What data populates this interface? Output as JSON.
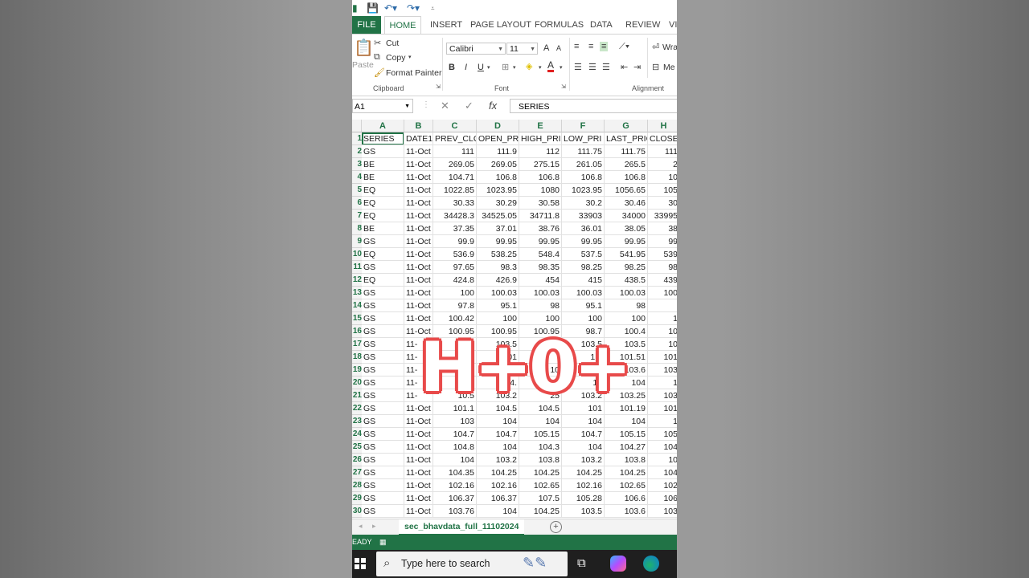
{
  "ribbon": {
    "tabs": [
      "FILE",
      "HOME",
      "INSERT",
      "PAGE LAYOUT",
      "FORMULAS",
      "DATA",
      "REVIEW",
      "VI"
    ],
    "clipboard": {
      "paste": "Paste",
      "cut": "Cut",
      "copy": "Copy",
      "format_painter": "Format Painter",
      "label": "Clipboard"
    },
    "font": {
      "name": "Calibri",
      "size": "11",
      "bold": "B",
      "italic": "I",
      "underline": "U",
      "grow": "A",
      "shrink": "A",
      "font_color": "A",
      "label": "Font"
    },
    "alignment": {
      "wrap": "Wra",
      "merge": "Me",
      "label": "Alignment"
    }
  },
  "formula_bar": {
    "name_box": "A1",
    "content": "SERIES"
  },
  "grid": {
    "columns": [
      "A",
      "B",
      "C",
      "D",
      "E",
      "F",
      "G",
      "H"
    ],
    "rows": [
      [
        "1",
        "SERIES",
        "DATE1",
        "PREV_CLO",
        "OPEN_PR",
        "HIGH_PRI",
        "LOW_PRI",
        "LAST_PRIC",
        "CLOSE"
      ],
      [
        "2",
        "GS",
        "11-Oct",
        "111",
        "111.9",
        "112",
        "111.75",
        "111.75",
        "111"
      ],
      [
        "3",
        "BE",
        "11-Oct",
        "269.05",
        "269.05",
        "275.15",
        "261.05",
        "265.5",
        "2"
      ],
      [
        "4",
        "BE",
        "11-Oct",
        "104.71",
        "106.8",
        "106.8",
        "106.8",
        "106.8",
        "10"
      ],
      [
        "5",
        "EQ",
        "11-Oct",
        "1022.85",
        "1023.95",
        "1080",
        "1023.95",
        "1056.65",
        "105"
      ],
      [
        "6",
        "EQ",
        "11-Oct",
        "30.33",
        "30.29",
        "30.58",
        "30.2",
        "30.46",
        "30"
      ],
      [
        "7",
        "EQ",
        "11-Oct",
        "34428.3",
        "34525.05",
        "34711.8",
        "33903",
        "34000",
        "33995"
      ],
      [
        "8",
        "BE",
        "11-Oct",
        "37.35",
        "37.01",
        "38.76",
        "36.01",
        "38.05",
        "38"
      ],
      [
        "9",
        "GS",
        "11-Oct",
        "99.9",
        "99.95",
        "99.95",
        "99.95",
        "99.95",
        "99"
      ],
      [
        "10",
        "EQ",
        "11-Oct",
        "536.9",
        "538.25",
        "548.4",
        "537.5",
        "541.95",
        "539"
      ],
      [
        "11",
        "GS",
        "11-Oct",
        "97.65",
        "98.3",
        "98.35",
        "98.25",
        "98.25",
        "98"
      ],
      [
        "12",
        "EQ",
        "11-Oct",
        "424.8",
        "426.9",
        "454",
        "415",
        "438.5",
        "439"
      ],
      [
        "13",
        "GS",
        "11-Oct",
        "100",
        "100.03",
        "100.03",
        "100.03",
        "100.03",
        "100"
      ],
      [
        "14",
        "GS",
        "11-Oct",
        "97.8",
        "95.1",
        "98",
        "95.1",
        "98",
        ""
      ],
      [
        "15",
        "GS",
        "11-Oct",
        "100.42",
        "100",
        "100",
        "100",
        "100",
        "1"
      ],
      [
        "16",
        "GS",
        "11-Oct",
        "100.95",
        "100.95",
        "100.95",
        "98.7",
        "100.4",
        "10"
      ],
      [
        "17",
        "GS",
        "11-",
        "",
        "103.5",
        "",
        "103.5",
        "103.5",
        "10"
      ],
      [
        "18",
        "GS",
        "11-",
        "",
        "101",
        "",
        "1.5",
        "101.51",
        "101"
      ],
      [
        "19",
        "GS",
        "11-",
        "",
        "",
        "10",
        "",
        "103.6",
        "103"
      ],
      [
        "20",
        "GS",
        "11-",
        "",
        "04.",
        "",
        "17",
        "104",
        "1"
      ],
      [
        "21",
        "GS",
        "11-",
        "10.5",
        "103.2",
        "25",
        "103.2",
        "103.25",
        "103"
      ],
      [
        "22",
        "GS",
        "11-Oct",
        "101.1",
        "104.5",
        "104.5",
        "101",
        "101.19",
        "101"
      ],
      [
        "23",
        "GS",
        "11-Oct",
        "103",
        "104",
        "104",
        "104",
        "104",
        "1"
      ],
      [
        "24",
        "GS",
        "11-Oct",
        "104.7",
        "104.7",
        "105.15",
        "104.7",
        "105.15",
        "105"
      ],
      [
        "25",
        "GS",
        "11-Oct",
        "104.8",
        "104",
        "104.3",
        "104",
        "104.27",
        "104"
      ],
      [
        "26",
        "GS",
        "11-Oct",
        "104",
        "103.2",
        "103.8",
        "103.2",
        "103.8",
        "10"
      ],
      [
        "27",
        "GS",
        "11-Oct",
        "104.35",
        "104.25",
        "104.25",
        "104.25",
        "104.25",
        "104"
      ],
      [
        "28",
        "GS",
        "11-Oct",
        "102.16",
        "102.16",
        "102.65",
        "102.16",
        "102.65",
        "102"
      ],
      [
        "29",
        "GS",
        "11-Oct",
        "106.37",
        "106.37",
        "107.5",
        "105.28",
        "106.6",
        "106"
      ],
      [
        "30",
        "GS",
        "11-Oct",
        "103.76",
        "104",
        "104.25",
        "103.5",
        "103.6",
        "103"
      ]
    ]
  },
  "overlay_text": "H+0+",
  "sheet_tab": "sec_bhavdata_full_11102024",
  "status_text": "EADY",
  "taskbar": {
    "search_placeholder": "Type here to search"
  },
  "colors": {
    "excel_green": "#217346",
    "overlay_red": "#e84a4a"
  }
}
